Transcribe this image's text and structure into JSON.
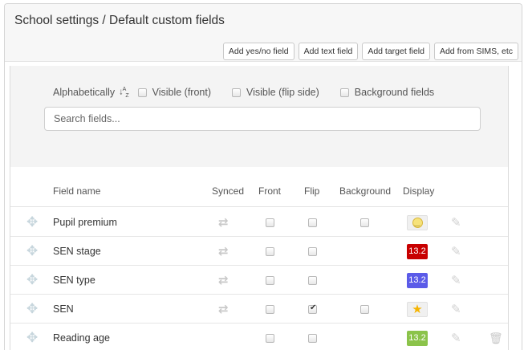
{
  "header": {
    "title": "School settings / Default custom fields",
    "buttons": [
      "Add yes/no field",
      "Add text field",
      "Add target field",
      "Add from SIMS, etc"
    ]
  },
  "filters": {
    "sort_label": "Alphabetically",
    "sort_icon": "↓A Z",
    "options": [
      {
        "label": "Visible (front)",
        "checked": false
      },
      {
        "label": "Visible (flip side)",
        "checked": false
      },
      {
        "label": "Background fields",
        "checked": false
      }
    ],
    "search_placeholder": "Search fields..."
  },
  "table": {
    "columns": {
      "field_name": "Field name",
      "synced": "Synced",
      "front": "Front",
      "flip": "Flip",
      "background": "Background",
      "display": "Display"
    },
    "rows": [
      {
        "name": "Pupil premium",
        "synced": true,
        "front": false,
        "flip": false,
        "background": false,
        "display": {
          "kind": "icon",
          "icon": "smiley-icon"
        },
        "deletable": false
      },
      {
        "name": "SEN stage",
        "synced": true,
        "front": false,
        "flip": false,
        "background": null,
        "display": {
          "kind": "number",
          "text": "13.2",
          "color": "#c80000"
        },
        "deletable": false
      },
      {
        "name": "SEN type",
        "synced": true,
        "front": false,
        "flip": false,
        "background": null,
        "display": {
          "kind": "number",
          "text": "13.2",
          "color": "#5b5be8"
        },
        "deletable": false
      },
      {
        "name": "SEN",
        "synced": true,
        "front": false,
        "flip": true,
        "background": false,
        "display": {
          "kind": "icon",
          "icon": "star-icon"
        },
        "deletable": false
      },
      {
        "name": "Reading age",
        "synced": false,
        "front": false,
        "flip": false,
        "background": null,
        "display": {
          "kind": "number",
          "text": "13.2",
          "color": "#8bc34a"
        },
        "deletable": true
      }
    ]
  }
}
